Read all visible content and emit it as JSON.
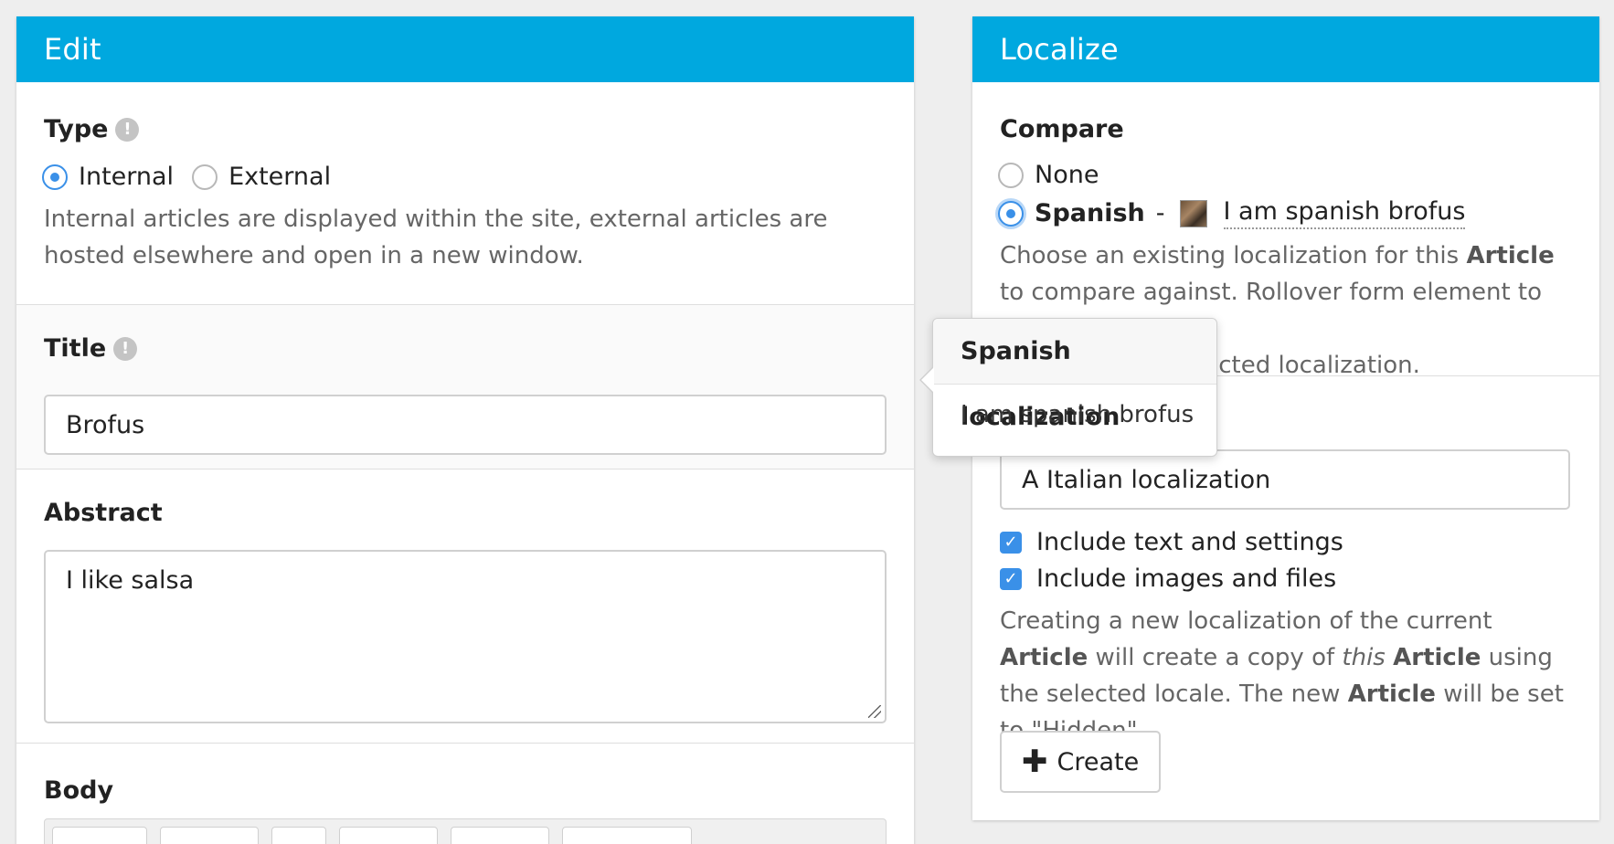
{
  "edit": {
    "header": "Edit",
    "type": {
      "label": "Type",
      "options": [
        "Internal",
        "External"
      ],
      "selected": "Internal",
      "help": "Internal articles are displayed within the site, external articles are hosted elsewhere and open in a new window."
    },
    "title": {
      "label": "Title",
      "value": "Brofus"
    },
    "abstract": {
      "label": "Abstract",
      "value": "I like salsa"
    },
    "body": {
      "label": "Body"
    }
  },
  "localize": {
    "header": "Localize",
    "compare": {
      "label": "Compare",
      "option_none": "None",
      "option_spanish_locale": "Spanish",
      "option_spanish_sep": "-",
      "option_spanish_title": "I am spanish brofus",
      "selected": "Spanish",
      "help_part1": "Choose an existing localization for this ",
      "help_bold1": "Article",
      "help_part2": " to compare against. Rollover form element to view",
      "help_part3": "elected localization."
    },
    "new_localization": {
      "value": "A Italian localization",
      "include_text": "Include text and settings",
      "include_images": "Include images and files",
      "help_part1": "Creating a new localization of the current ",
      "help_bold1": "Article",
      "help_part2": " will create a copy of ",
      "help_italic": "this",
      "help_bold2": "Article",
      "help_part3": " using the selected locale. The new ",
      "help_bold3": "Article",
      "help_part4": " will be set to \"Hidden\".",
      "create_label": "Create"
    }
  },
  "tooltip": {
    "title": "Spanish localization",
    "body": "I am spanish brofus"
  },
  "colors": {
    "header_bg": "#00a8df",
    "accent": "#3a90e8"
  }
}
